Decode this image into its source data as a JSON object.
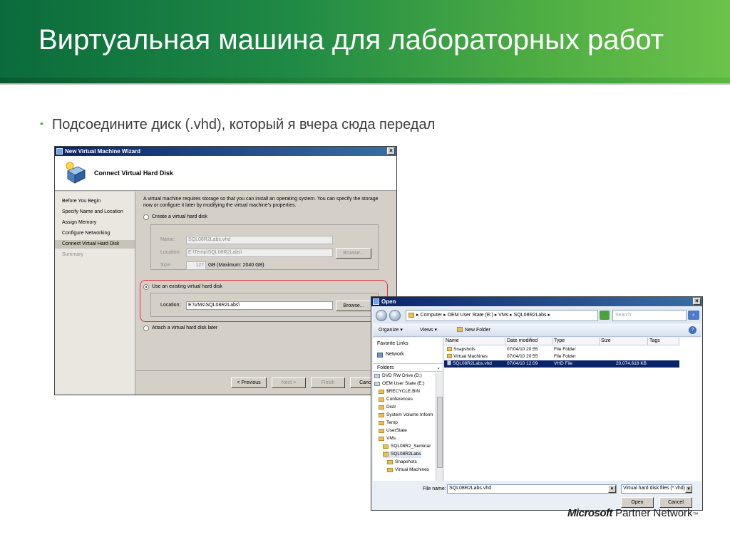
{
  "slide": {
    "title": "Виртуальная машина для лабораторных работ",
    "bullet": "Подсоедините диск (.vhd), который я вчера сюда передал",
    "logo_brand": "Microsoft",
    "logo_product": "Partner Network",
    "logo_tm": "™"
  },
  "wizard": {
    "title": "New Virtual Machine Wizard",
    "close": "×",
    "heading": "Connect Virtual Hard Disk",
    "nav": [
      "Before You Begin",
      "Specify Name and Location",
      "Assign Memory",
      "Configure Networking",
      "Connect Virtual Hard Disk",
      "Summary"
    ],
    "description": "A virtual machine requires storage so that you can install an operating system. You can specify the storage now or configure it later by modifying the virtual machine's properties.",
    "create_option": "Create a virtual hard disk",
    "name_label": "Name:",
    "name_value": "SQL08R2Labs.vhd",
    "location_label": "Location:",
    "location_value": "E:\\Temp\\SQL08R2Labs\\",
    "browse": "Browse...",
    "size_label": "Size:",
    "size_value": "127",
    "size_note": "GB (Maximum: 2040 GB)",
    "existing_option": "Use an existing virtual hard disk",
    "existing_location_label": "Location:",
    "existing_location_value": "E:\\VMs\\SQL08R2Labs\\",
    "existing_browse": "Browse...",
    "attach_option": "Attach a virtual hard disk later",
    "btn_previous": "< Previous",
    "btn_next": "Next >",
    "btn_finish": "Finish",
    "btn_cancel": "Cancel"
  },
  "open_dialog": {
    "title": "Open",
    "close": "×",
    "breadcrumb": "▸ Computer ▸ OEM User State (E:) ▸ VMs ▸ SQL08R2Labs ▸",
    "search_placeholder": "Search",
    "organize": "Organize ▾",
    "views": "Views ▾",
    "new_folder": "New Folder",
    "favorite_links": "Favorite Links",
    "network": "Network",
    "folders": "Folders",
    "tree": [
      "DVD RW Drive (D:)",
      "OEM User State (E:)",
      "$RECYCLE.BIN",
      "Conferences",
      "Distr",
      "System Volume Inform",
      "Temp",
      "UserState",
      "VMs",
      "SQL08R2_Seminar",
      "SQL08R2Labs",
      "Snapshots",
      "Virtual Machines"
    ],
    "columns": [
      "Name",
      "Date modified",
      "Type",
      "Size",
      "Tags"
    ],
    "files": [
      {
        "name": "Snapshots",
        "date": "07/04/10 20:55",
        "type": "File Folder",
        "size": ""
      },
      {
        "name": "Virtual Machines",
        "date": "07/04/10 20:55",
        "type": "File Folder",
        "size": ""
      },
      {
        "name": "SQL08R2Labs.vhd",
        "date": "07/04/10 12:09",
        "type": "VHD File",
        "size": "20,074,618 KB"
      }
    ],
    "filename_label": "File name:",
    "filename_value": "SQL08R2Labs.vhd",
    "filter_value": "Virtual hard disk files   (*.vhd)",
    "btn_open": "Open",
    "btn_cancel": "Cancel"
  }
}
